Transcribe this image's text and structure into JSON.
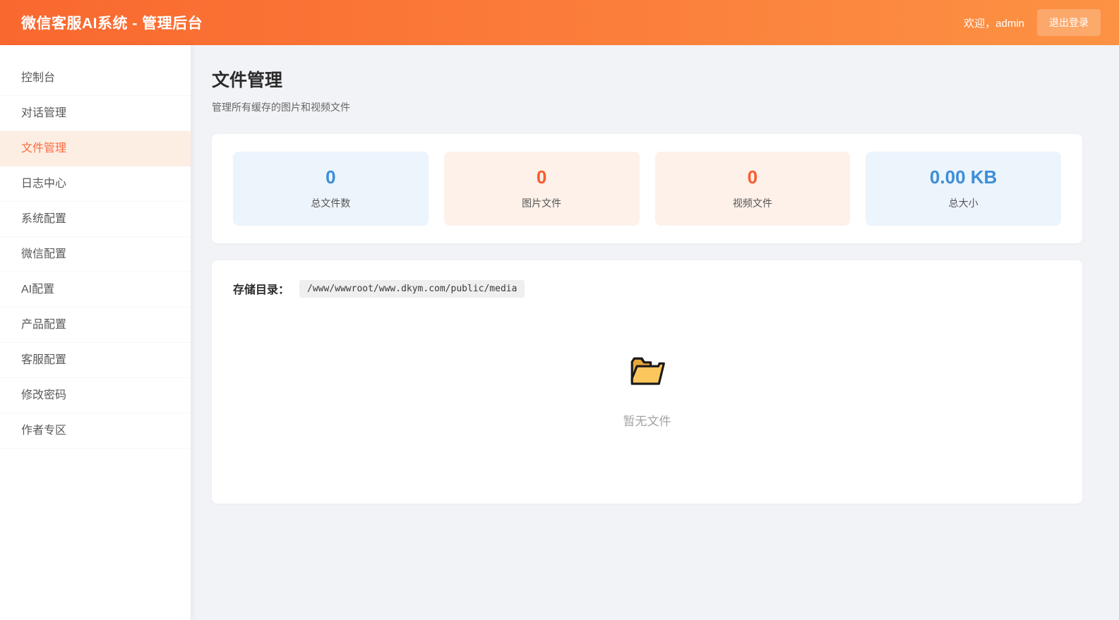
{
  "header": {
    "title": "微信客服AI系统 - 管理后台",
    "welcome": "欢迎，admin",
    "logout_label": "退出登录"
  },
  "sidebar": {
    "items": [
      {
        "id": "console",
        "label": "控制台",
        "active": false
      },
      {
        "id": "conversations",
        "label": "对话管理",
        "active": false
      },
      {
        "id": "files",
        "label": "文件管理",
        "active": true
      },
      {
        "id": "logs",
        "label": "日志中心",
        "active": false
      },
      {
        "id": "system-config",
        "label": "系统配置",
        "active": false
      },
      {
        "id": "wechat-config",
        "label": "微信配置",
        "active": false
      },
      {
        "id": "ai-config",
        "label": "AI配置",
        "active": false
      },
      {
        "id": "product-config",
        "label": "产品配置",
        "active": false
      },
      {
        "id": "service-config",
        "label": "客服配置",
        "active": false
      },
      {
        "id": "change-password",
        "label": "修改密码",
        "active": false
      },
      {
        "id": "author-zone",
        "label": "作者专区",
        "active": false
      }
    ]
  },
  "page": {
    "title": "文件管理",
    "subtitle": "管理所有缓存的图片和视频文件"
  },
  "stats": [
    {
      "value": "0",
      "label": "总文件数",
      "theme": "blue"
    },
    {
      "value": "0",
      "label": "图片文件",
      "theme": "orange"
    },
    {
      "value": "0",
      "label": "视频文件",
      "theme": "orange"
    },
    {
      "value": "0.00 KB",
      "label": "总大小",
      "theme": "blue"
    }
  ],
  "storage": {
    "label": "存储目录：",
    "path": "/www/wwwroot/www.dkym.com/public/media"
  },
  "empty_state": {
    "icon": "open-folder-icon",
    "text": "暂无文件"
  },
  "colors": {
    "header_gradient_start": "#f9682f",
    "header_gradient_end": "#fc9243",
    "active_menu_bg": "#fdeee4",
    "active_menu_text": "#fc6c3f",
    "stat_blue_text": "#3d8ed8",
    "stat_blue_bg": "#ecf4fc",
    "stat_orange_text": "#fc5a2d",
    "stat_orange_bg": "#fdf1ea",
    "page_bg": "#f2f3f7"
  }
}
